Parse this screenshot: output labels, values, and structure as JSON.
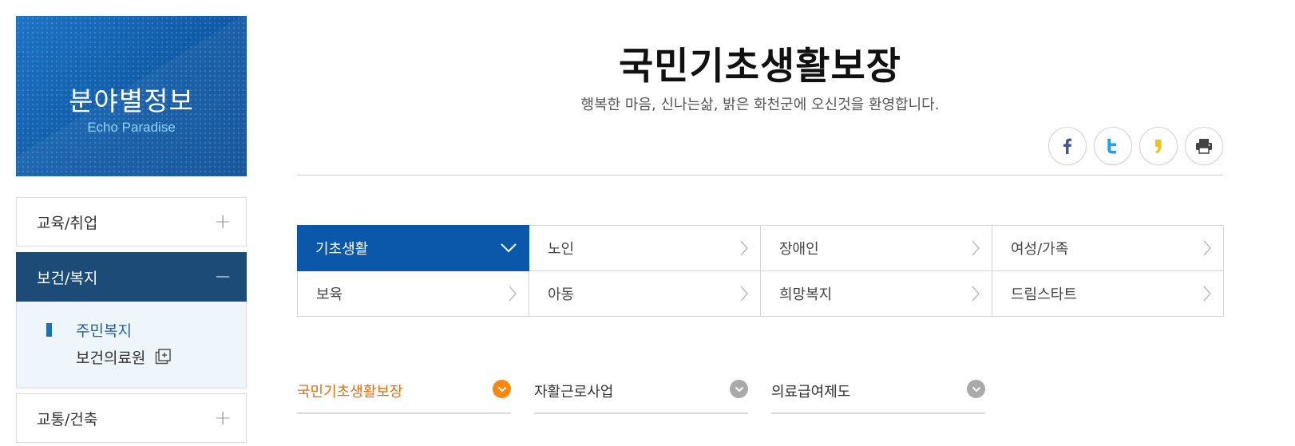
{
  "banner": {
    "title": "분야별정보",
    "subtitle": "Echo Paradise"
  },
  "sidebar": {
    "items": [
      {
        "label": "교육/취업",
        "toggle": "+"
      },
      {
        "label": "보건/복지",
        "toggle": "−"
      },
      {
        "label": "교통/건축",
        "toggle": "+"
      }
    ],
    "submenu": [
      {
        "label": "주민복지"
      },
      {
        "label": "보건의료원"
      }
    ]
  },
  "header": {
    "title": "국민기초생활보장",
    "welcome": "행복한 마음, 신나는삶, 밝은 화천군에 오신것을 환영합니다."
  },
  "share": [
    "facebook-icon",
    "twitter-icon",
    "kakaostory-icon",
    "print-icon"
  ],
  "categories": [
    {
      "label": "기초생활"
    },
    {
      "label": "노인"
    },
    {
      "label": "장애인"
    },
    {
      "label": "여성/가족"
    },
    {
      "label": "보육"
    },
    {
      "label": "아동"
    },
    {
      "label": "희망복지"
    },
    {
      "label": "드림스타트"
    }
  ],
  "subtabs": [
    {
      "label": "국민기초생활보장"
    },
    {
      "label": "자활근로사업"
    },
    {
      "label": "의료급여제도"
    }
  ],
  "colors": {
    "banner": "#1565b4",
    "menu_active": "#1c4b78",
    "category_active": "#0b57aa",
    "subtab_active": "#ea6d0a"
  }
}
